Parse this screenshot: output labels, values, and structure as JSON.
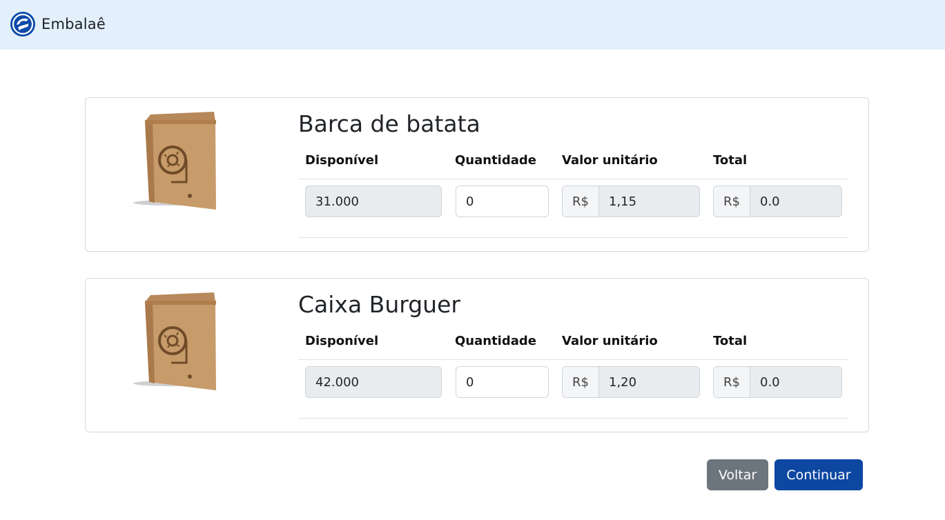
{
  "navbar": {
    "brand": "Embalaê",
    "logo_icon": "embalae-logo-icon"
  },
  "columns": {
    "available": "Disponível",
    "quantity": "Quantidade",
    "unit_price": "Valor unitário",
    "total": "Total"
  },
  "products": [
    {
      "name": "Barca de batata",
      "available": "31.000",
      "quantity": "0",
      "currency": "R$",
      "unit_price": "1,15",
      "total": "0.0",
      "image_icon": "kraft-paper-bag-image"
    },
    {
      "name": "Caixa Burguer",
      "available": "42.000",
      "quantity": "0",
      "currency": "R$",
      "unit_price": "1,20",
      "total": "0.0",
      "image_icon": "kraft-paper-bag-image"
    }
  ],
  "actions": {
    "back": "Voltar",
    "continue": "Continuar"
  },
  "colors": {
    "navbar_bg": "#e3f0fc",
    "primary": "#0d47a1",
    "secondary": "#6c757d",
    "readonly_bg": "#e9ecef"
  }
}
